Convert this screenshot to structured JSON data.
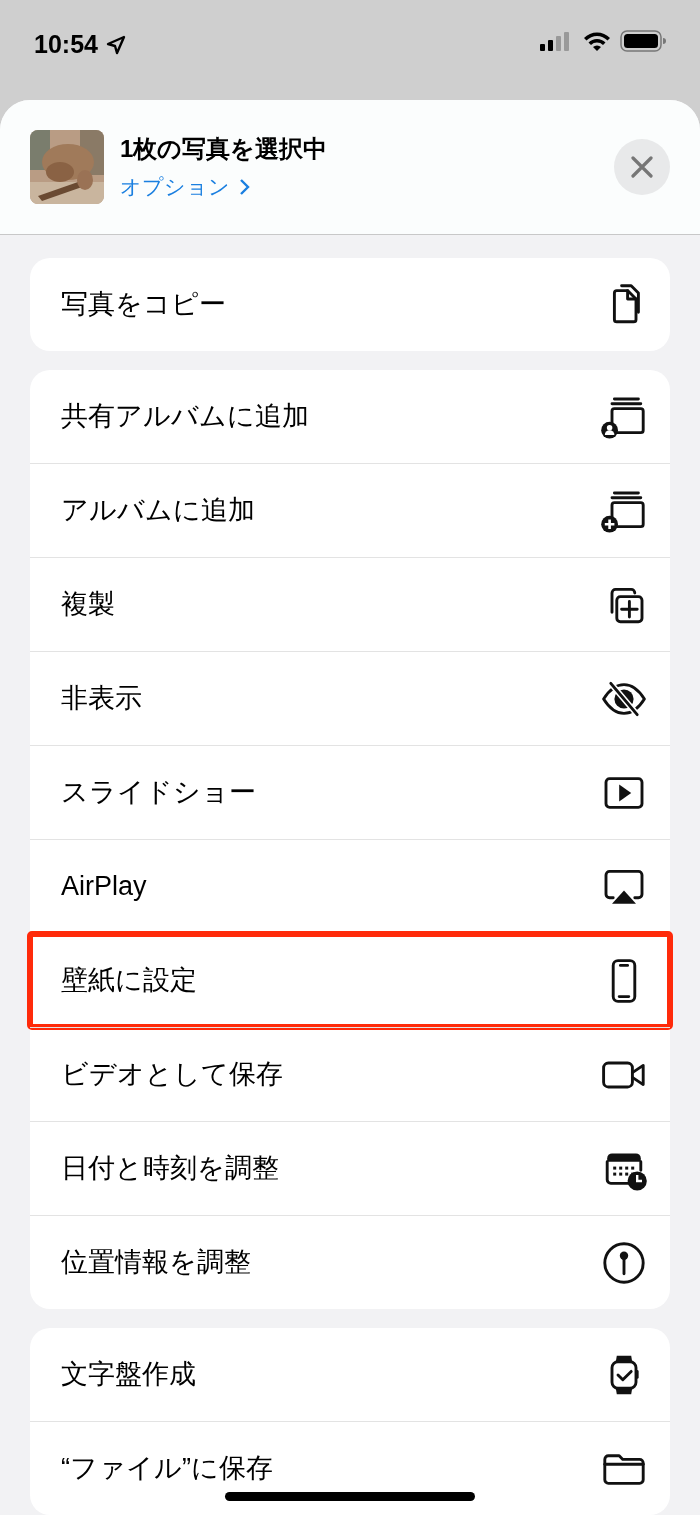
{
  "status_bar": {
    "time": "10:54"
  },
  "header": {
    "title": "1枚の写真を選択中",
    "options_link": "オプション"
  },
  "groups": [
    {
      "items": [
        {
          "label": "写真をコピー",
          "highlighted": false
        }
      ]
    },
    {
      "items": [
        {
          "label": "共有アルバムに追加",
          "highlighted": false
        },
        {
          "label": "アルバムに追加",
          "highlighted": false
        },
        {
          "label": "複製",
          "highlighted": false
        },
        {
          "label": "非表示",
          "highlighted": false
        },
        {
          "label": "スライドショー",
          "highlighted": false
        },
        {
          "label": "AirPlay",
          "highlighted": false
        },
        {
          "label": "壁紙に設定",
          "highlighted": true
        },
        {
          "label": "ビデオとして保存",
          "highlighted": false
        },
        {
          "label": "日付と時刻を調整",
          "highlighted": false
        },
        {
          "label": "位置情報を調整",
          "highlighted": false
        }
      ]
    },
    {
      "items": [
        {
          "label": "文字盤作成",
          "highlighted": false
        },
        {
          "label": "“ファイル”に保存",
          "highlighted": false
        }
      ]
    }
  ]
}
